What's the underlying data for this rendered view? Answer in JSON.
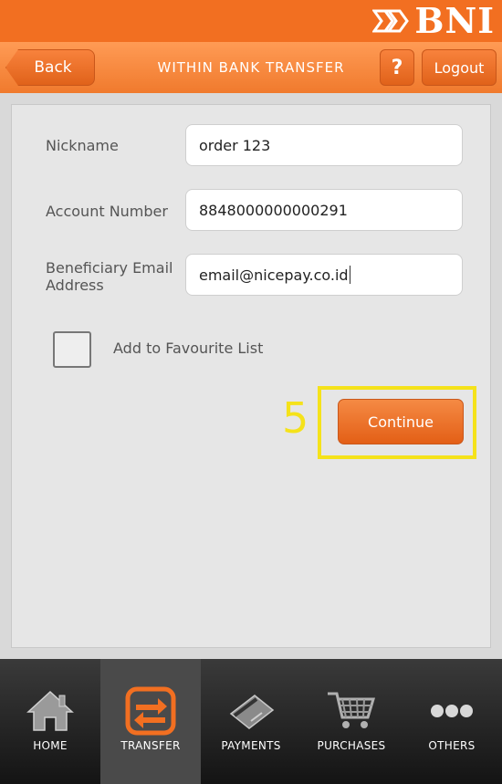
{
  "brand": {
    "name": "BNI",
    "color": "#f26f21"
  },
  "navbar": {
    "back_label": "Back",
    "title": "WITHIN BANK TRANSFER",
    "help_label": "?",
    "logout_label": "Logout"
  },
  "form": {
    "nickname": {
      "label": "Nickname",
      "value": "order 123"
    },
    "account_number": {
      "label": "Account Number",
      "value": "8848000000000291"
    },
    "beneficiary_email": {
      "label_line1": "Beneficiary Email",
      "label_line2": "Address",
      "value": "email@nicepay.co.id"
    },
    "favourite": {
      "label": "Add to Favourite List",
      "checked": false
    },
    "continue_label": "Continue"
  },
  "annotation": {
    "step_number": "5",
    "color": "#f5e21a"
  },
  "tabbar": {
    "active": "TRANSFER",
    "tabs": [
      {
        "label": "HOME",
        "icon": "home-icon"
      },
      {
        "label": "TRANSFER",
        "icon": "transfer-icon"
      },
      {
        "label": "PAYMENTS",
        "icon": "card-icon"
      },
      {
        "label": "PURCHASES",
        "icon": "cart-icon"
      },
      {
        "label": "OTHERS",
        "icon": "more-icon"
      }
    ]
  }
}
